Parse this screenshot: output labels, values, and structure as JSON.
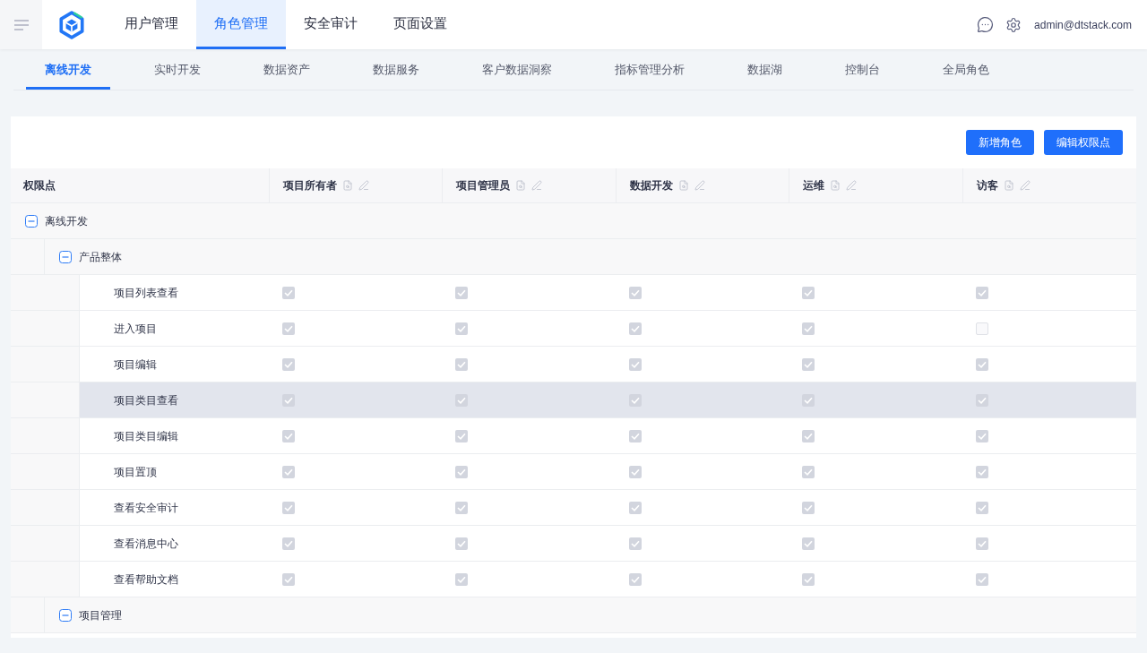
{
  "header": {
    "nav": [
      {
        "label": "用户管理",
        "selected": false
      },
      {
        "label": "角色管理",
        "selected": true
      },
      {
        "label": "安全审计",
        "selected": false
      },
      {
        "label": "页面设置",
        "selected": false
      }
    ],
    "user": "admin@dtstack.com"
  },
  "product_tabs": [
    {
      "label": "离线开发",
      "selected": true
    },
    {
      "label": "实时开发",
      "selected": false
    },
    {
      "label": "数据资产",
      "selected": false
    },
    {
      "label": "数据服务",
      "selected": false
    },
    {
      "label": "客户数据洞察",
      "selected": false
    },
    {
      "label": "指标管理分析",
      "selected": false
    },
    {
      "label": "数据湖",
      "selected": false
    },
    {
      "label": "控制台",
      "selected": false
    },
    {
      "label": "全局角色",
      "selected": false
    }
  ],
  "actions": [
    "新增角色",
    "编辑权限点"
  ],
  "table": {
    "columns": [
      "权限点",
      "项目所有者",
      "项目管理员",
      "数据开发",
      "运维",
      "访客"
    ],
    "checks_disabled": true,
    "rows": [
      {
        "kind": "group",
        "label": "离线开发",
        "expanded": true,
        "children": [
          {
            "kind": "group",
            "label": "产品整体",
            "expanded": true,
            "children": [
              {
                "kind": "permission",
                "label": "项目列表查看",
                "hovered": false,
                "checks": [
                  true,
                  true,
                  true,
                  true,
                  true
                ]
              },
              {
                "kind": "permission",
                "label": "进入项目",
                "hovered": false,
                "checks": [
                  true,
                  true,
                  true,
                  true,
                  false
                ]
              },
              {
                "kind": "permission",
                "label": "项目编辑",
                "hovered": false,
                "checks": [
                  true,
                  true,
                  true,
                  true,
                  true
                ]
              },
              {
                "kind": "permission",
                "label": "项目类目查看",
                "hovered": true,
                "checks": [
                  true,
                  true,
                  true,
                  true,
                  true
                ]
              },
              {
                "kind": "permission",
                "label": "项目类目编辑",
                "hovered": false,
                "checks": [
                  true,
                  true,
                  true,
                  true,
                  true
                ]
              },
              {
                "kind": "permission",
                "label": "项目置顶",
                "hovered": false,
                "checks": [
                  true,
                  true,
                  true,
                  true,
                  true
                ]
              },
              {
                "kind": "permission",
                "label": "查看安全审计",
                "hovered": false,
                "checks": [
                  true,
                  true,
                  true,
                  true,
                  true
                ]
              },
              {
                "kind": "permission",
                "label": "查看消息中心",
                "hovered": false,
                "checks": [
                  true,
                  true,
                  true,
                  true,
                  true
                ]
              },
              {
                "kind": "permission",
                "label": "查看帮助文档",
                "hovered": false,
                "checks": [
                  true,
                  true,
                  true,
                  true,
                  true
                ]
              }
            ]
          },
          {
            "kind": "group",
            "label": "项目管理",
            "expanded": true
          }
        ]
      }
    ]
  }
}
